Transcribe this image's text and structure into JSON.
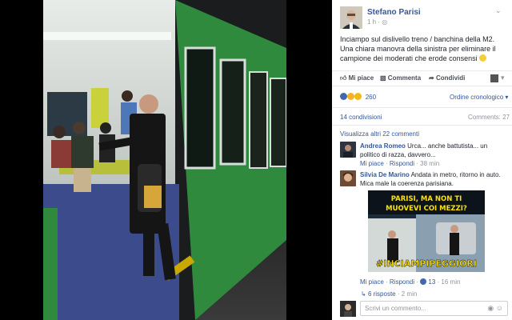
{
  "post": {
    "author": "Stefano Parisi",
    "time": "1 h",
    "privacy_icon": "globe-icon",
    "text": "Inciampo sul dislivello treno / banchina della M2. Una chiara manovra della sinistra per eliminare il campione dei moderati che erode consensi",
    "emoji_icon": "smiley-icon"
  },
  "actions": {
    "like": "Mi piace",
    "comment": "Commenta",
    "share": "Condividi"
  },
  "reactions": {
    "count": "260",
    "types": [
      "like",
      "haha",
      "wow"
    ]
  },
  "order_label": "Ordine cronologico",
  "shares_label": "14 condivisioni",
  "comments_count_label": "Comments: 27",
  "view_more_label": "Visualizza altri 22 commenti",
  "comments": [
    {
      "name": "Andrea Romeo",
      "text": "Urca... anche battutista... un politico di razza, davvero...",
      "like": "Mi piace",
      "reply": "Rispondi",
      "time": "38 min"
    },
    {
      "name": "Silvia De Marino",
      "text": "Andata in metro, ritorno in auto. Mica male la coerenza parisiana.",
      "meme_top": "PARISI, MA NON TI MUOVEVI COI MEZZI?",
      "meme_tag": "#INCIAMPIPEGGIORI",
      "like": "Mi piace",
      "reply": "Rispondi",
      "likes": "13",
      "time": "16 min"
    }
  ],
  "replies_label": "6 risposte",
  "replies_time": "2 min",
  "write_placeholder": "Scrivi un commento...",
  "colors": {
    "link": "#365899",
    "metro_green": "#2f8a3e",
    "meme_accent": "#ffe100"
  }
}
